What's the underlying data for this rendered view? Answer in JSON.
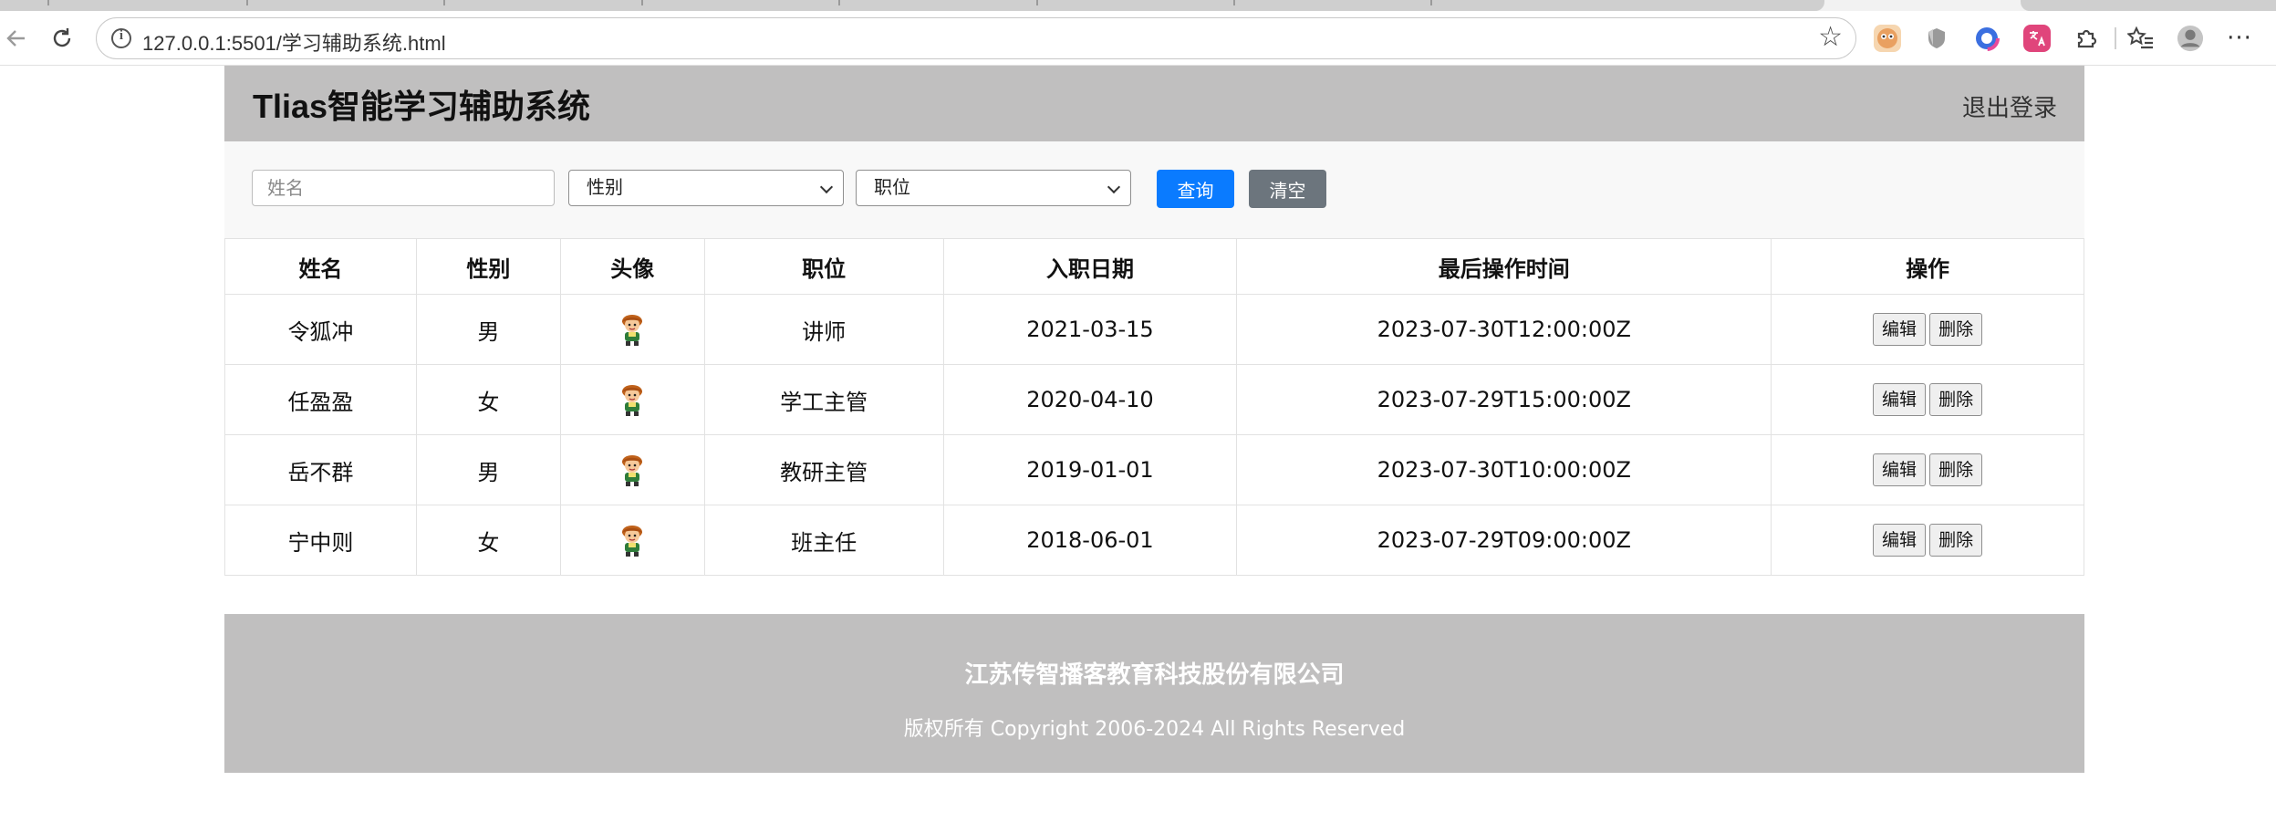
{
  "browser": {
    "url": "127.0.0.1:5501/学习辅助系统.html"
  },
  "header": {
    "title": "Tlias智能学习辅助系统",
    "logout_label": "退出登录"
  },
  "search": {
    "name_placeholder": "姓名",
    "gender_select": "性别",
    "job_select": "职位",
    "query_label": "查询",
    "clear_label": "清空"
  },
  "table": {
    "headers": [
      "姓名",
      "性别",
      "头像",
      "职位",
      "入职日期",
      "最后操作时间",
      "操作"
    ],
    "rows": [
      {
        "name": "令狐冲",
        "gender": "男",
        "job": "讲师",
        "entry_date": "2021-03-15",
        "update_time": "2023-07-30T12:00:00Z"
      },
      {
        "name": "任盈盈",
        "gender": "女",
        "job": "学工主管",
        "entry_date": "2020-04-10",
        "update_time": "2023-07-29T15:00:00Z"
      },
      {
        "name": "岳不群",
        "gender": "男",
        "job": "教研主管",
        "entry_date": "2019-01-01",
        "update_time": "2023-07-30T10:00:00Z"
      },
      {
        "name": "宁中则",
        "gender": "女",
        "job": "班主任",
        "entry_date": "2018-06-01",
        "update_time": "2023-07-29T09:00:00Z"
      }
    ],
    "edit_label": "编辑",
    "delete_label": "删除"
  },
  "footer": {
    "company": "江苏传智播客教育科技股份有限公司",
    "copyright": "版权所有 Copyright 2006-2024 All Rights Reserved"
  },
  "colors": {
    "header_bg": "#c0bfbf",
    "primary": "#0a7bff",
    "secondary": "#6c757d"
  }
}
